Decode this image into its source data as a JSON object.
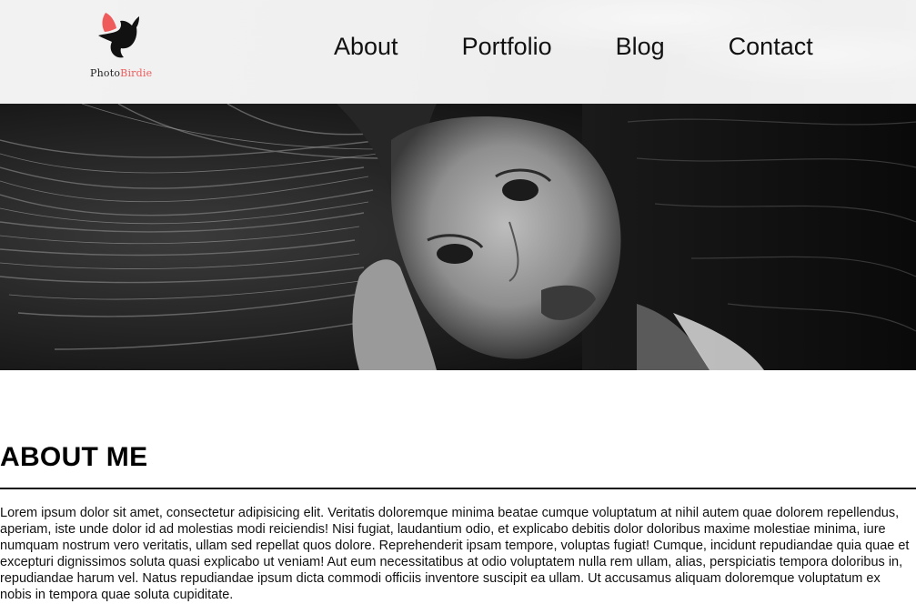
{
  "brand": {
    "name_part1": "Photo",
    "name_part2": "Birdie",
    "accent_color": "#ef5a5a",
    "logo_icon": "bird-icon"
  },
  "nav": {
    "items": [
      {
        "label": "About"
      },
      {
        "label": "Portfolio"
      },
      {
        "label": "Blog"
      },
      {
        "label": "Contact"
      }
    ]
  },
  "hero": {
    "image": "black-and-white portrait photo"
  },
  "about": {
    "title": "ABOUT ME",
    "body": "Lorem ipsum dolor sit amet, consectetur adipisicing elit. Veritatis doloremque minima beatae cumque voluptatum at nihil autem quae dolorem repellendus, aperiam, iste unde dolor id ad molestias modi reiciendis! Nisi fugiat, laudantium odio, et explicabo debitis dolor doloribus maxime molestiae minima, iure numquam nostrum vero veritatis, ullam sed repellat quos dolore. Reprehenderit ipsam tempore, voluptas fugiat! Cumque, incidunt repudiandae quia quae et excepturi dignissimos soluta quasi explicabo ut veniam! Aut eum necessitatibus at odio voluptatem nulla rem ullam, alias, perspiciatis tempora doloribus in, repudiandae harum vel. Natus repudiandae ipsum dicta commodi officiis inventore suscipit ea ullam. Ut accusamus aliquam doloremque voluptatum ex nobis in tempora quae soluta cupiditate."
  }
}
